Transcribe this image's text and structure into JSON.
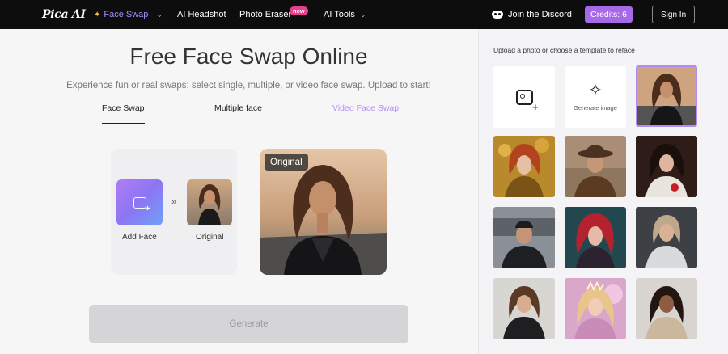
{
  "nav": {
    "logo": "Pica AI",
    "face_swap": "Face Swap",
    "ai_headshot": "AI Headshot",
    "photo_eraser": "Photo Eraser",
    "new_badge": "new",
    "ai_tools": "AI Tools",
    "discord": "Join the Discord",
    "credits": "Credits: 6",
    "sign_in": "Sign In"
  },
  "main": {
    "title": "Free Face Swap Online",
    "subtitle": "Experience fun or real swaps: select single, multiple, or video face swap. Upload to start!",
    "tabs": [
      {
        "label": "Face Swap",
        "active": true
      },
      {
        "label": "Multiple face",
        "active": false
      },
      {
        "label": "Video Face Swap",
        "active": false
      }
    ],
    "add_face_label": "Add Face",
    "original_label": "Original",
    "arrow": "»",
    "preview_tag": "Original",
    "generate": "Generate"
  },
  "sidebar": {
    "title": "Upload a photo or choose a template to reface",
    "generate_image": "Generate image"
  },
  "colors": {
    "accent": "#a66ae6",
    "nav_bg": "#0d0d0d",
    "tab_video": "#b58cf0",
    "new_badge": "#e83e8c"
  },
  "icons": [
    "image-plus-icon",
    "sparkle-icon",
    "discord-icon",
    "chevron-down-icon"
  ]
}
